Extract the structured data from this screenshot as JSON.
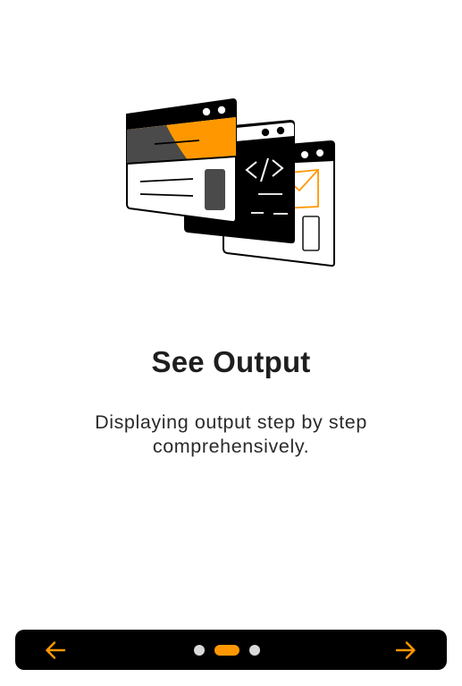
{
  "slide": {
    "title": "See Output",
    "description": "Displaying output step by step comprehensively.",
    "illustration_icon": "browser-windows-illustration"
  },
  "navigation": {
    "prev_icon": "arrow-left-icon",
    "next_icon": "arrow-right-icon",
    "total_pages": 3,
    "current_page": 2
  },
  "colors": {
    "accent": "#ff9800",
    "nav_background": "#000000",
    "inactive_dot": "#d9d9d9",
    "dark_gray": "#4a4a4a"
  }
}
